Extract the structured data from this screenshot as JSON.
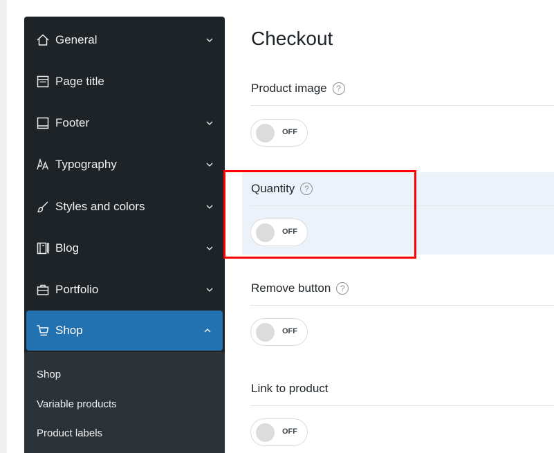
{
  "sidebar": {
    "items": [
      {
        "label": "General",
        "icon": "home-icon",
        "expanded": false
      },
      {
        "label": "Page title",
        "icon": "page-title-icon"
      },
      {
        "label": "Footer",
        "icon": "footer-icon",
        "expanded": false
      },
      {
        "label": "Typography",
        "icon": "typography-icon",
        "expanded": false
      },
      {
        "label": "Styles and colors",
        "icon": "brush-icon",
        "expanded": false
      },
      {
        "label": "Blog",
        "icon": "blog-icon",
        "expanded": false
      },
      {
        "label": "Portfolio",
        "icon": "portfolio-icon",
        "expanded": false
      },
      {
        "label": "Shop",
        "icon": "cart-icon",
        "expanded": true,
        "active": true
      }
    ],
    "submenu": [
      "Shop",
      "Variable products",
      "Product labels"
    ],
    "colors": {
      "background": "#1d2327",
      "active": "#2271b1",
      "submenu": "#2c3338"
    }
  },
  "main": {
    "title": "Checkout",
    "settings": [
      {
        "label": "Product image",
        "state": "OFF"
      },
      {
        "label": "Quantity",
        "state": "OFF",
        "highlighted": true
      },
      {
        "label": "Remove button",
        "state": "OFF"
      },
      {
        "label": "Link to product",
        "state": "OFF"
      }
    ],
    "help_glyph": "?"
  },
  "annotation": {
    "color": "#ff0000"
  }
}
